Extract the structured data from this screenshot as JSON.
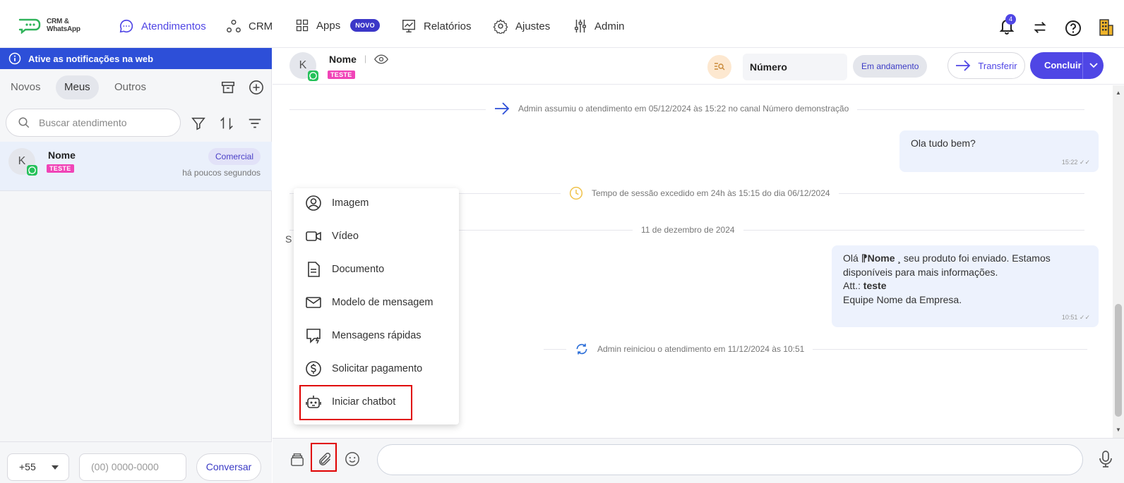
{
  "logo": {
    "line1": "CRM &",
    "line2": "WhatsApp"
  },
  "nav": {
    "atendimentos": "Atendimentos",
    "crm": "CRM",
    "apps": "Apps",
    "apps_badge": "NOVO",
    "relatorios": "Relatórios",
    "ajustes": "Ajustes",
    "admin": "Admin",
    "notification_count": "4"
  },
  "sidebar": {
    "banner": "Ative as notificações na web",
    "tabs": [
      "Novos",
      "Meus",
      "Outros"
    ],
    "active_tab": "Meus",
    "search_placeholder": "Buscar atendimento",
    "conversation": {
      "avatar": "K",
      "name": "Nome",
      "tag": "TESTE",
      "department": "Comercial",
      "time": "há poucos segundos"
    },
    "footer": {
      "ddd": "+55",
      "phone_placeholder": "(00) 0000-0000",
      "button": "Conversar"
    }
  },
  "chat_header": {
    "avatar": "K",
    "name": "Nome",
    "separator": "|",
    "tag": "TESTE",
    "channel_field": "Número",
    "status": "Em andamento",
    "transfer": "Transferir",
    "conclude": "Concluir"
  },
  "messages": {
    "sys1": "Admin assumiu o atendimento em 05/12/2024 às 15:22 no canal Número demonstração",
    "bubble1": {
      "text": "Ola tudo bem?",
      "time": "15:22"
    },
    "sys2": "Tempo de sessão excedido em 24h às 15:15 do dia 06/12/2024",
    "date_divider": "11 de dezembro de 2024",
    "bubble2": {
      "line1a": "Olá ",
      "line1b": "⁋Nome ¸",
      "line1c": " seu produto foi enviado. Estamos",
      "line2": "disponíveis para mais informações.",
      "line3a": "Att.: ",
      "line3b": "teste",
      "line4": "Equipe Nome da Empresa.",
      "time": "10:51"
    },
    "sys3": "Admin reiniciou o atendimento em 11/12/2024 às 10:51",
    "partial_char": "S"
  },
  "attach_menu": {
    "items": [
      "Imagem",
      "Vídeo",
      "Documento",
      "Modelo de mensagem",
      "Mensagens rápidas",
      "Solicitar pagamento",
      "Iniciar chatbot"
    ]
  },
  "colors": {
    "accent": "#4f46e5",
    "banner": "#2d4fd8",
    "tag_pink": "#f044b7",
    "highlight": "#e00000"
  }
}
